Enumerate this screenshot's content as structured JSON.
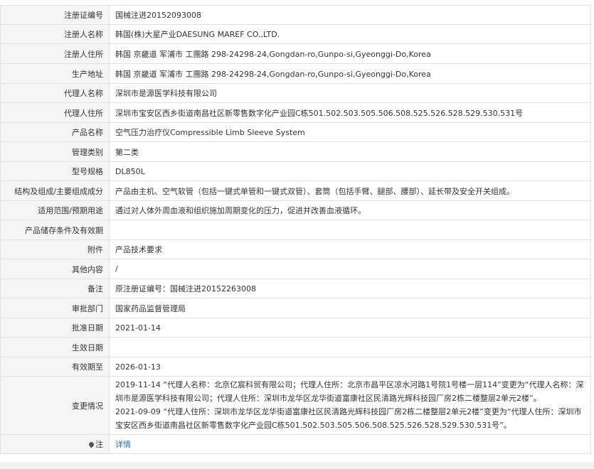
{
  "rows": [
    {
      "label": "注册证编号",
      "value": "国械注进20152093008"
    },
    {
      "label": "注册人名称",
      "value": "韩国(株)大星产业DAESUNG MAREF CO.,LTD."
    },
    {
      "label": "注册人住所",
      "value": "韩国 京畿道 军浦市 工團路 298-24298-24,Gongdan-ro,Gunpo-si,Gyeonggi-Do,Korea"
    },
    {
      "label": "生产地址",
      "value": "韩国 京畿道 军浦市 工團路 298-24298-24,Gongdan-ro,Gunpo-si,Gyeonggi-Do,Korea"
    },
    {
      "label": "代理人名称",
      "value": "深圳市是源医学科技有限公司"
    },
    {
      "label": "代理人住所",
      "value": "深圳市宝安区西乡街道南昌社区新零售数字化产业园C栋501.502.503.505.506.508.525.526.528.529.530.531号"
    },
    {
      "label": "产品名称",
      "value": "空气压力治疗仪Compressible Limb Sleeve System"
    },
    {
      "label": "管理类别",
      "value": "第二类"
    },
    {
      "label": "型号规格",
      "value": "DL850L"
    },
    {
      "label": "结构及组成/主要组成成分",
      "value": "产品由主机、空气软管（包括一键式单管和一键式双管）、套筒（包括手臂、腿部、腰部）、延长带及安全开关组成。"
    },
    {
      "label": "适用范围/预期用途",
      "value": "通过对人体外周血液和组织施加周期变化的压力，促进并改善血液循环。"
    },
    {
      "label": "产品储存条件及有效期",
      "value": ""
    },
    {
      "label": "附件",
      "value": "产品技术要求"
    },
    {
      "label": "其他内容",
      "value": "/"
    },
    {
      "label": "备注",
      "value": "原注册证编号：国械注进20152263008"
    },
    {
      "label": "审批部门",
      "value": "国家药品监督管理局"
    },
    {
      "label": "批准日期",
      "value": "2021-01-14"
    },
    {
      "label": "生效日期",
      "value": ""
    },
    {
      "label": "有效期至",
      "value": "2026-01-13"
    }
  ],
  "changes": {
    "label": "变更情况",
    "entries": [
      "2019-11-14 “代理人名称：北京亿宸科贸有限公司；代理人住所：北京市昌平区凉水河路1号院1号楼一层114”变更为“代理人名称：深圳市是源医学科技有限公司；代理人住所：深圳市龙华区龙华街道富康社区民清路光辉科技园厂房2栋二楼整层2单元2楼”。",
      "2021-09-09 “代理人住所：深圳市龙华区龙华街道富康社区民清路光辉科技园厂房2栋二楼整层2单元2楼”变更为“代理人住所：深圳市宝安区西乡街道南昌社区新零售数字化产业园C栋501.502.503.505.506.508.525.526.528.529.530.531号”。"
    ]
  },
  "note": {
    "label": "注",
    "icon": "pin-icon",
    "link_text": "详情"
  }
}
